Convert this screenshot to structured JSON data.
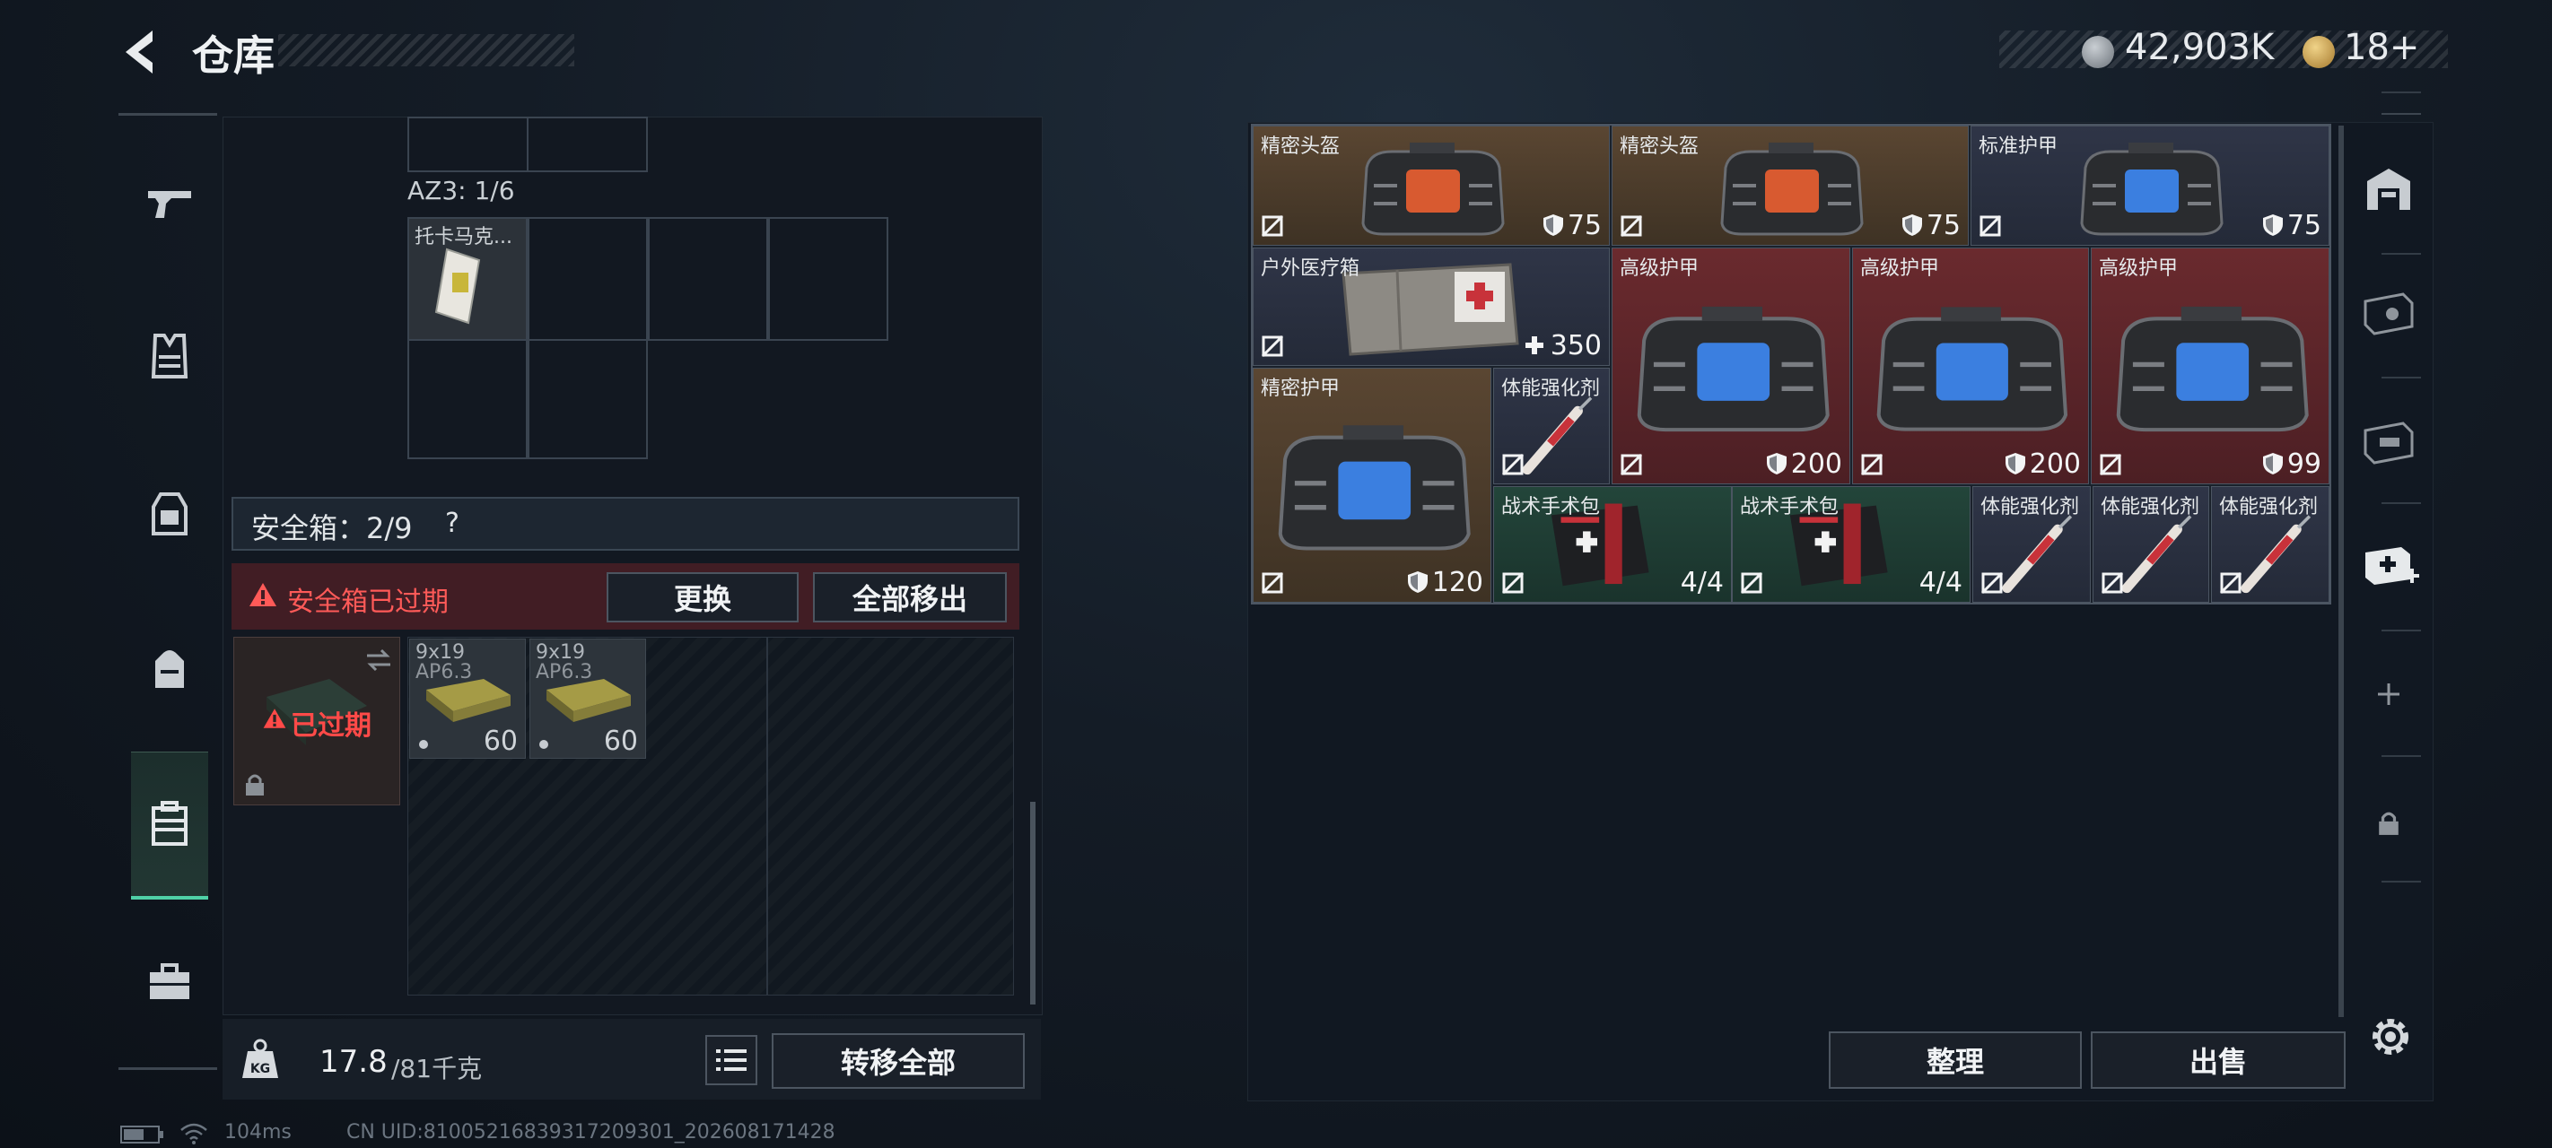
{
  "header": {
    "title": "仓库",
    "currency": "42,903K",
    "tokens": "18+"
  },
  "left_nav": {
    "items": [
      {
        "icon": "gun-icon",
        "active": false
      },
      {
        "icon": "vest-icon",
        "active": false
      },
      {
        "icon": "chest-rig-icon",
        "active": false
      },
      {
        "icon": "backpack-icon",
        "active": false
      },
      {
        "icon": "safe-case-icon",
        "active": true
      },
      {
        "icon": "toolbox-icon",
        "active": false
      }
    ]
  },
  "container": {
    "label": "AZ3: 1/6",
    "item_name": "托卡马克..."
  },
  "safe_box": {
    "label": "安全箱：2/9",
    "help": "?",
    "expired_notice": "安全箱已过期",
    "replace_button": "更换",
    "remove_all_button": "全部移出",
    "case_status": "已过期",
    "ammo": [
      {
        "name": "9x19",
        "sub": "AP6.3",
        "count": "60"
      },
      {
        "name": "9x19",
        "sub": "AP6.3",
        "count": "60"
      }
    ]
  },
  "footer_left": {
    "weight": "17.8",
    "weight_max": "/81千克",
    "transfer_all_button": "转移全部"
  },
  "stash": {
    "items": [
      {
        "name": "精密头盔",
        "value": "75",
        "value_icon": "shield-icon"
      },
      {
        "name": "精密头盔",
        "value": "75",
        "value_icon": "shield-icon"
      },
      {
        "name": "标准护甲",
        "value": "75",
        "value_icon": "shield-icon"
      },
      {
        "name": "户外医疗箱",
        "value": "350",
        "value_icon": "plus-icon"
      },
      {
        "name": "高级护甲",
        "value": "200",
        "value_icon": "shield-icon"
      },
      {
        "name": "高级护甲",
        "value": "200",
        "value_icon": "shield-icon"
      },
      {
        "name": "高级护甲",
        "value": "99",
        "value_icon": "shield-icon"
      },
      {
        "name": "精密护甲",
        "value": "120",
        "value_icon": "shield-icon"
      },
      {
        "name": "体能强化剂",
        "value": "",
        "value_icon": ""
      },
      {
        "name": "战术手术包",
        "value": "4/4",
        "value_icon": ""
      },
      {
        "name": "战术手术包",
        "value": "4/4",
        "value_icon": ""
      },
      {
        "name": "体能强化剂",
        "value": "",
        "value_icon": ""
      },
      {
        "name": "体能强化剂",
        "value": "",
        "value_icon": ""
      },
      {
        "name": "体能强化剂",
        "value": "",
        "value_icon": ""
      }
    ],
    "sort_button": "整理",
    "sell_button": "出售"
  },
  "status": {
    "ping": "104ms",
    "uid": "CN UID:810052168393172093​01_202608171428"
  }
}
